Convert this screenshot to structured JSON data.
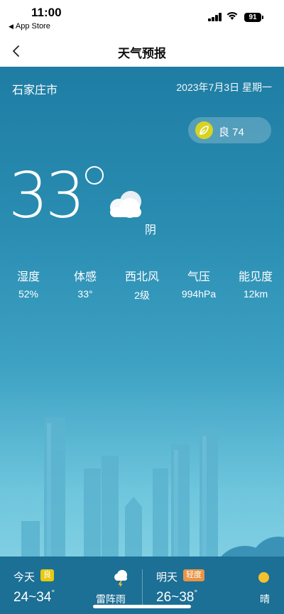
{
  "status": {
    "time": "11:00",
    "back_app": "App Store",
    "battery": "91"
  },
  "nav": {
    "title": "天气预报"
  },
  "location": {
    "city": "石家庄市",
    "date": "2023年7月3日  星期一"
  },
  "aqi": {
    "label": "良 74",
    "color": "#d7d321"
  },
  "current": {
    "temp": "33",
    "condition": "阴"
  },
  "metrics": [
    {
      "label": "湿度",
      "value": "52%"
    },
    {
      "label": "体感",
      "value": "33°"
    },
    {
      "label": "西北风",
      "value": "2级"
    },
    {
      "label": "气压",
      "value": "994hPa"
    },
    {
      "label": "能见度",
      "value": "12km"
    }
  ],
  "forecast": {
    "today": {
      "day": "今天",
      "badge": "良",
      "badge_color": "#e9c90f",
      "range": "24~34",
      "condition": "雷阵雨",
      "icon": "thunderstorm-icon"
    },
    "tomorrow": {
      "day": "明天",
      "badge": "轻度",
      "badge_color": "#e89547",
      "range": "26~38",
      "condition": "晴",
      "icon": "sun-icon"
    }
  }
}
